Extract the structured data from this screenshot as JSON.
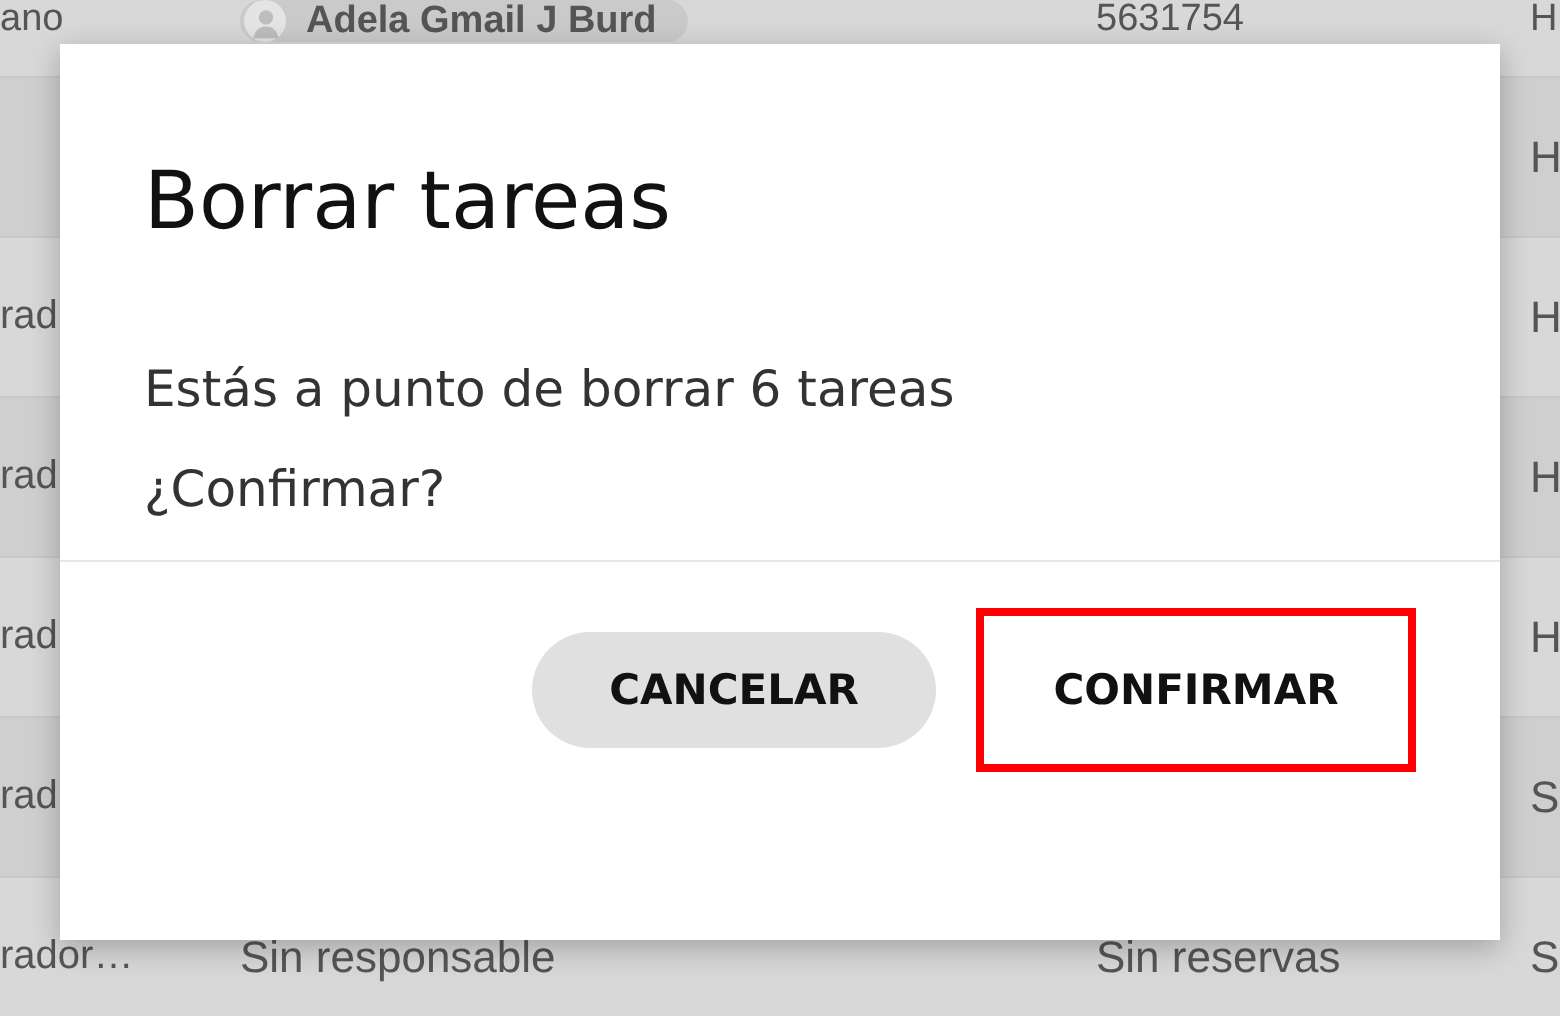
{
  "table": {
    "rows": [
      {
        "column_1": "ano",
        "assignee": {
          "name": "Adela Gmail J Burd"
        },
        "column_3": "5631754",
        "column_4": "H"
      },
      {
        "column_4": "H"
      },
      {
        "column_1": "rad",
        "column_4": "H"
      },
      {
        "column_1": "rad",
        "column_4": "H"
      },
      {
        "column_1": "rad",
        "column_4": "H"
      },
      {
        "column_1": "rad",
        "column_4": "S"
      },
      {
        "column_1": "rador…",
        "column_2": "Sin responsable",
        "column_3": "Sin reservas",
        "column_4": "S"
      }
    ]
  },
  "dialog": {
    "title": "Borrar tareas",
    "message": "Estás a punto de borrar 6 tareas",
    "question": "¿Confirmar?",
    "buttons": [
      {
        "label": "CANCELAR",
        "kind": "secondary",
        "highlighted": false
      },
      {
        "label": "CONFIRMAR",
        "kind": "primary",
        "highlighted": true
      }
    ]
  }
}
